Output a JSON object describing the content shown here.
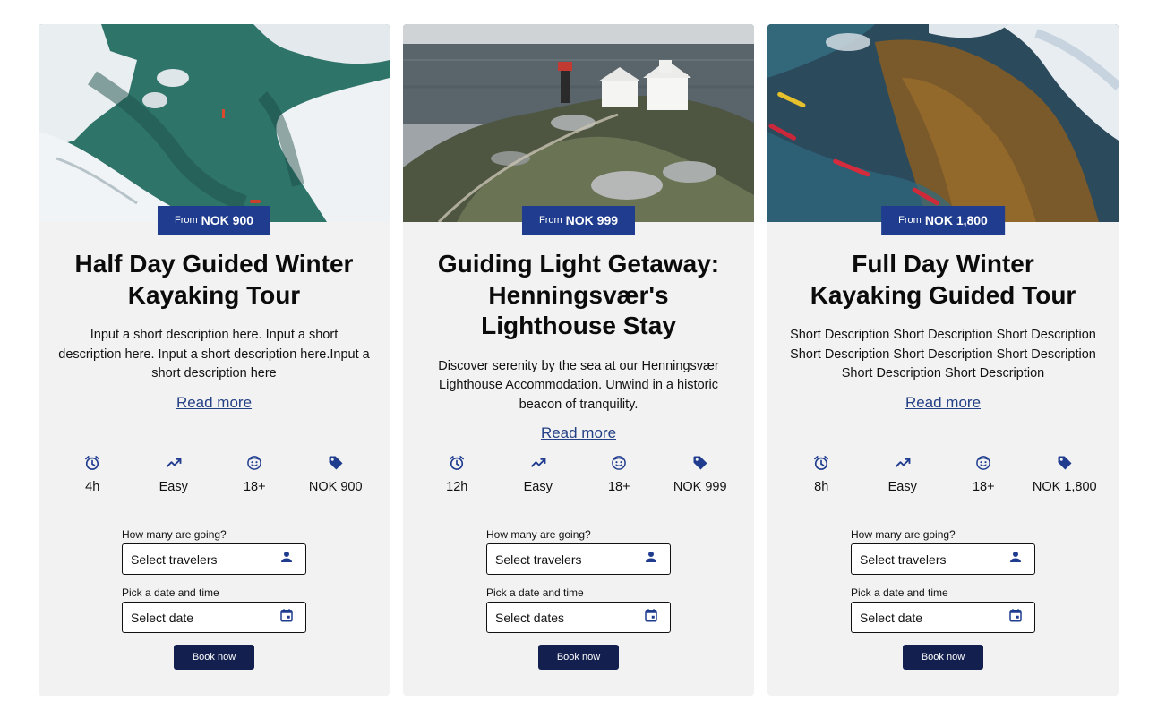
{
  "accent_color": "#1f3c8f",
  "button_color": "#13204f",
  "link_color": "#233f85",
  "cards": [
    {
      "image": "aerial-winter-fjord-kayak-photo",
      "price_prefix": "From",
      "price": "NOK 900",
      "title": "Half Day Guided Winter Kayaking Tour",
      "description": "Input a short description here. Input a short description here. Input a short description here.Input a short description here",
      "read_more": "Read more",
      "features": [
        {
          "icon": "alarm-clock-icon",
          "value": "4h"
        },
        {
          "icon": "trending-up-icon",
          "value": "Easy"
        },
        {
          "icon": "face-icon",
          "value": "18+"
        },
        {
          "icon": "price-tag-icon",
          "value": "NOK 900"
        }
      ],
      "travelers_label": "How many are going?",
      "travelers_placeholder": "Select travelers",
      "date_label": "Pick a date and time",
      "date_placeholder": "Select date",
      "book_label": "Book now"
    },
    {
      "image": "lighthouse-on-rocky-coast-photo",
      "price_prefix": "From",
      "price": "NOK 999",
      "title": "Guiding Light Getaway: Henningsvær's Lighthouse Stay",
      "description": "Discover serenity by the sea at our Henningsvær Lighthouse Accommodation. Unwind in a historic beacon of tranquility.",
      "read_more": "Read more",
      "features": [
        {
          "icon": "alarm-clock-icon",
          "value": "12h"
        },
        {
          "icon": "trending-up-icon",
          "value": "Easy"
        },
        {
          "icon": "face-icon",
          "value": "18+"
        },
        {
          "icon": "price-tag-icon",
          "value": "NOK 999"
        }
      ],
      "travelers_label": "How many are going?",
      "travelers_placeholder": "Select travelers",
      "date_label": "Pick a date and time",
      "date_placeholder": "Select dates",
      "book_label": "Book now"
    },
    {
      "image": "aerial-kayaks-over-seaweed-photo",
      "price_prefix": "From",
      "price": "NOK 1,800",
      "title": "Full Day Winter Kayaking Guided Tour",
      "description": "Short Description Short Description Short Description Short Description Short Description Short Description Short Description Short Description",
      "read_more": "Read more",
      "features": [
        {
          "icon": "alarm-clock-icon",
          "value": "8h"
        },
        {
          "icon": "trending-up-icon",
          "value": "Easy"
        },
        {
          "icon": "face-icon",
          "value": "18+"
        },
        {
          "icon": "price-tag-icon",
          "value": "NOK 1,800"
        }
      ],
      "travelers_label": "How many are going?",
      "travelers_placeholder": "Select travelers",
      "date_label": "Pick a date and time",
      "date_placeholder": "Select date",
      "book_label": "Book now"
    }
  ]
}
